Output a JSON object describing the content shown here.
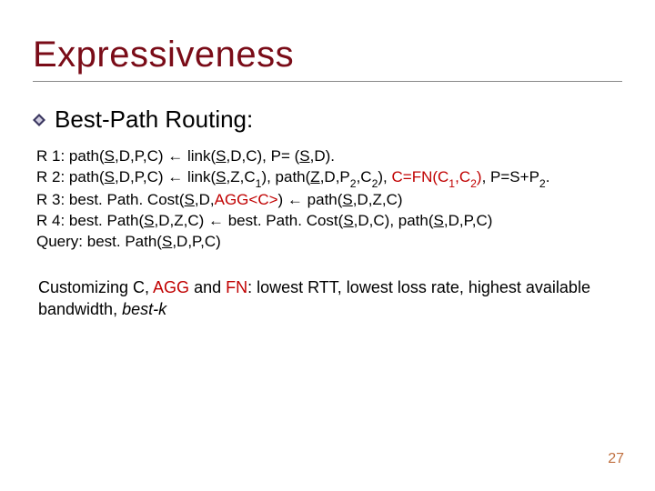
{
  "title": "Expressiveness",
  "sub_heading": "Best-Path Routing:",
  "bullet_icon": "diamond-bullet-icon",
  "rules": {
    "r1": {
      "label": "R 1:",
      "body_parts": [
        "path(",
        "S",
        ",D,P,C) ← link(",
        "S",
        ",D,C), P= (",
        "S",
        ",D)."
      ]
    },
    "r2": {
      "label": "R 2:",
      "body_parts_a": [
        "path(",
        "S",
        ",D,P,C) ← link(",
        "S",
        ",Z,C"
      ],
      "c1": "1",
      "mid1": "), path(",
      "z_u": "Z",
      "mid2": ",D,P",
      "p2": "2",
      "mid3": ",C",
      "c2a": "2",
      "mid4": "), ",
      "red_fn_a": "C=FN(C",
      "red_c1": "1",
      "red_mid": ",C",
      "red_c2": "2",
      "red_close": ")",
      "tail_a": ", P=S+P",
      "p2b": "2",
      "tail_b": "."
    },
    "r3": {
      "label": "R 3:",
      "body_a": "best. Path. Cost(",
      "s_u": "S",
      "body_b": ",D,",
      "agg": "AGG<C>",
      "body_c": ") ← path(",
      "s_u2": "S",
      "body_d": ",D,Z,C)"
    },
    "r4": {
      "label": "R 4:",
      "body_a": "best. Path(",
      "s_u": "S",
      "body_b": ",D,Z,C) ← best. Path. Cost(",
      "s_u2": "S",
      "body_c": ",D,C), path(",
      "s_u3": "S",
      "body_d": ",D,P,C)"
    },
    "query": {
      "label": "Query:",
      "body_a": " best. Path(",
      "s_u": "S",
      "body_b": ",D,P,C)"
    }
  },
  "note": {
    "prefix": "Customizing C, ",
    "agg": "AGG",
    "mid": " and ",
    "fn": "FN",
    "tail_a": ": lowest RTT, lowest loss rate, highest available bandwidth, ",
    "ital": "best-k"
  },
  "page_number": "27",
  "colors": {
    "title": "#7a0c18",
    "accent_red": "#c00000",
    "pagenum": "#c07040"
  }
}
